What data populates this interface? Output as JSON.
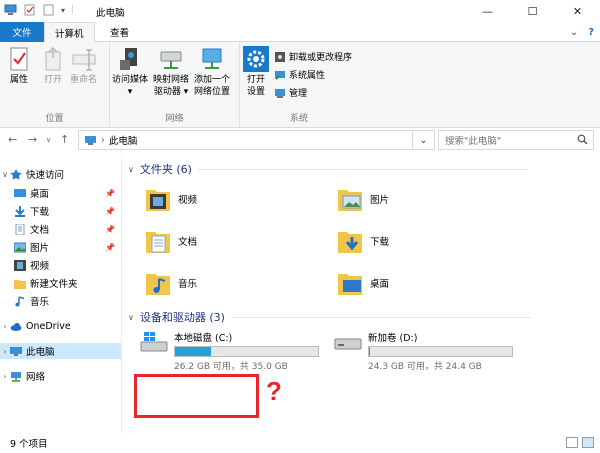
{
  "window": {
    "title": "此电脑",
    "minimize": "—",
    "maximize": "☐",
    "close": "✕"
  },
  "tabs": {
    "file": "文件",
    "computer": "计算机",
    "view": "查看"
  },
  "ribbon": {
    "location_group": {
      "label": "位置",
      "properties": "属性",
      "open": "打开",
      "rename": "重命名"
    },
    "network_group": {
      "label": "网络",
      "access_media_1": "访问媒体",
      "access_media_2": "▾",
      "map_drive_1": "映射网络",
      "map_drive_2": "驱动器 ▾",
      "add_location_1": "添加一个",
      "add_location_2": "网络位置"
    },
    "system_group": {
      "label": "系统",
      "open_settings_1": "打开",
      "open_settings_2": "设置",
      "uninstall": "卸载或更改程序",
      "system_properties": "系统属性",
      "manage": "管理"
    }
  },
  "address": {
    "path": "此电脑",
    "search_placeholder": "搜索\"此电脑\""
  },
  "nav": {
    "quick_access": "快速访问",
    "items": [
      {
        "label": "桌面",
        "pinned": true
      },
      {
        "label": "下载",
        "pinned": true
      },
      {
        "label": "文档",
        "pinned": true
      },
      {
        "label": "图片",
        "pinned": true
      },
      {
        "label": "视频",
        "pinned": false
      },
      {
        "label": "新建文件夹",
        "pinned": false
      },
      {
        "label": "音乐",
        "pinned": false
      }
    ],
    "onedrive": "OneDrive",
    "this_pc": "此电脑",
    "network": "网络"
  },
  "folders_section": {
    "title": "文件夹 (6)"
  },
  "folders": [
    {
      "label": "视频"
    },
    {
      "label": "图片"
    },
    {
      "label": "文档"
    },
    {
      "label": "下载"
    },
    {
      "label": "音乐"
    },
    {
      "label": "桌面"
    }
  ],
  "drives_section": {
    "title": "设备和驱动器 (3)"
  },
  "drives": [
    {
      "name": "本地磁盘 (C:)",
      "space": "26.2 GB 可用，共 35.0 GB",
      "used_fraction": 0.25
    },
    {
      "name": "新加卷 (D:)",
      "space": "24.3 GB 可用，共 24.4 GB",
      "used_fraction": 0.004
    }
  ],
  "annotation": {
    "question": "?"
  },
  "status": {
    "count": "9 个项目"
  },
  "colors": {
    "accent": "#1979ca",
    "selection": "#cce8ff",
    "red": "#e8262b",
    "header": "#1e3287"
  }
}
